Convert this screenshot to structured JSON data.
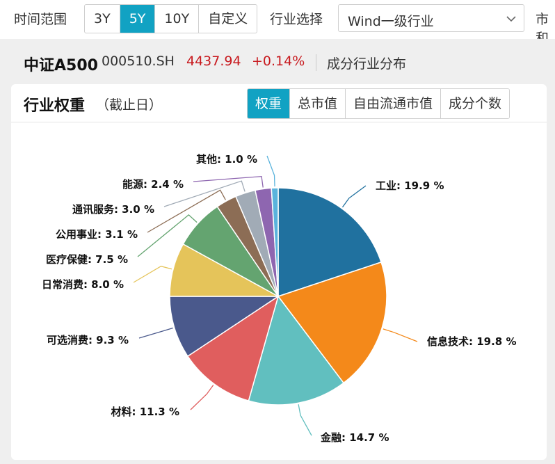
{
  "filters": {
    "time_range_label": "时间范围",
    "time_options": [
      "3Y",
      "5Y",
      "10Y",
      "自定义"
    ],
    "time_active_index": 1,
    "industry_label": "行业选择",
    "industry_value": "Wind一级行业",
    "cut_label": "市和"
  },
  "index_info": {
    "name": "中证A500",
    "code": "000510.SH",
    "price": "4437.94",
    "change": "+0.14%",
    "section": "成分行业分布"
  },
  "card": {
    "title": "行业权重",
    "subtitle": "（截止日）",
    "tabs": [
      "权重",
      "总市值",
      "自由流通市值",
      "成分个数"
    ],
    "active_tab_index": 0
  },
  "colors": {
    "accent": "#11a2c3",
    "up": "#c8191e"
  },
  "chart_data": {
    "type": "pie",
    "unit": "%",
    "slices": [
      {
        "name": "工业",
        "value": 19.9,
        "label": "工业: 19.9 %",
        "color": "#20719f"
      },
      {
        "name": "信息技术",
        "value": 19.8,
        "label": "信息技术: 19.8 %",
        "color": "#f4891a"
      },
      {
        "name": "金融",
        "value": 14.7,
        "label": "金融: 14.7 %",
        "color": "#61bfbf"
      },
      {
        "name": "材料",
        "value": 11.3,
        "label": "材料: 11.3 %",
        "color": "#e05e5e"
      },
      {
        "name": "可选消费",
        "value": 9.3,
        "label": "可选消费: 9.3 %",
        "color": "#4a598c"
      },
      {
        "name": "日常消费",
        "value": 8.0,
        "label": "日常消费: 8.0 %",
        "color": "#e5c45a"
      },
      {
        "name": "医疗保健",
        "value": 7.5,
        "label": "医疗保健: 7.5 %",
        "color": "#64a470"
      },
      {
        "name": "公用事业",
        "value": 3.1,
        "label": "公用事业: 3.1 %",
        "color": "#8c6d55"
      },
      {
        "name": "通讯服务",
        "value": 3.0,
        "label": "通讯服务: 3.0 %",
        "color": "#a1abb6"
      },
      {
        "name": "能源",
        "value": 2.4,
        "label": "能源: 2.4 %",
        "color": "#8e66b0"
      },
      {
        "name": "其他",
        "value": 1.0,
        "label": "其他: 1.0 %",
        "color": "#5ab3dc"
      }
    ]
  }
}
